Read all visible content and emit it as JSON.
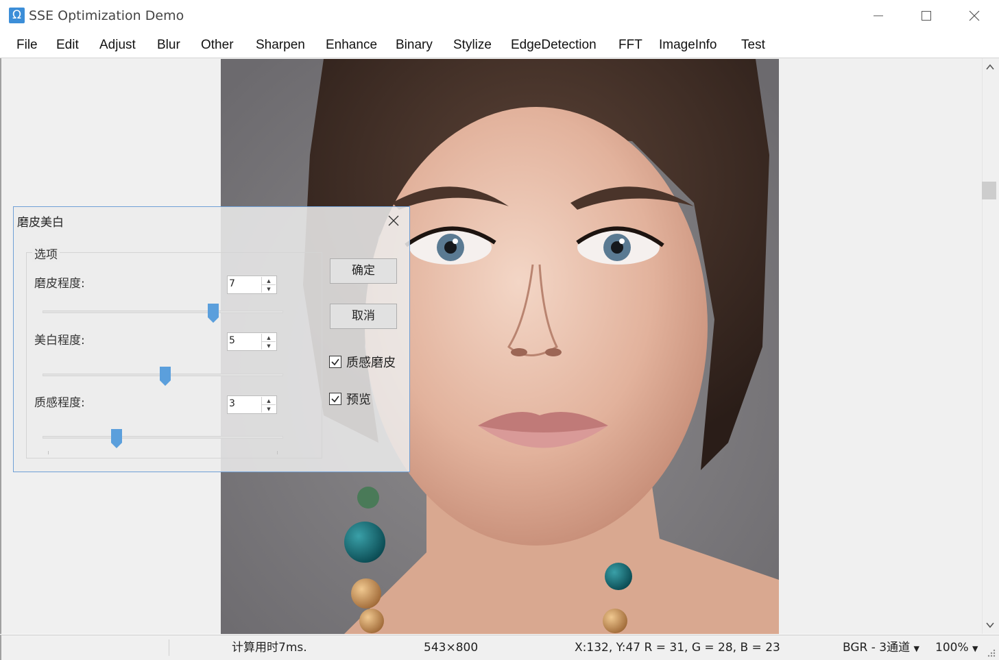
{
  "window": {
    "title": "SSE Optimization Demo",
    "icon_glyph": "Ω",
    "icon_color": "#3c8ed8"
  },
  "menu": [
    "File",
    "Edit",
    "Adjust",
    "Blur",
    "Other",
    "Sharpen",
    "Enhance",
    "Binary",
    "Stylize",
    "EdgeDetection",
    "FFT",
    "ImageInfo",
    "Test"
  ],
  "dialog": {
    "title": "磨皮美白",
    "group_label": "选项",
    "fields": [
      {
        "label": "磨皮程度:",
        "value": "7",
        "level": 0.7
      },
      {
        "label": "美白程度:",
        "value": "5",
        "level": 0.5
      },
      {
        "label": "质感程度:",
        "value": "3",
        "level": 0.3
      }
    ],
    "ok_label": "确定",
    "cancel_label": "取消",
    "checkboxes": [
      {
        "label": "质感磨皮",
        "checked": true
      },
      {
        "label": "预览",
        "checked": true
      }
    ],
    "accent_color": "#5b9fdc"
  },
  "status": {
    "time": "计算用时7ms.",
    "size": "543×800",
    "pixel": "X:132, Y:47   R = 31, G = 28, B = 23",
    "format": "BGR - 3通道",
    "zoom": "100%"
  },
  "vertical_scroll_position": 0.21
}
